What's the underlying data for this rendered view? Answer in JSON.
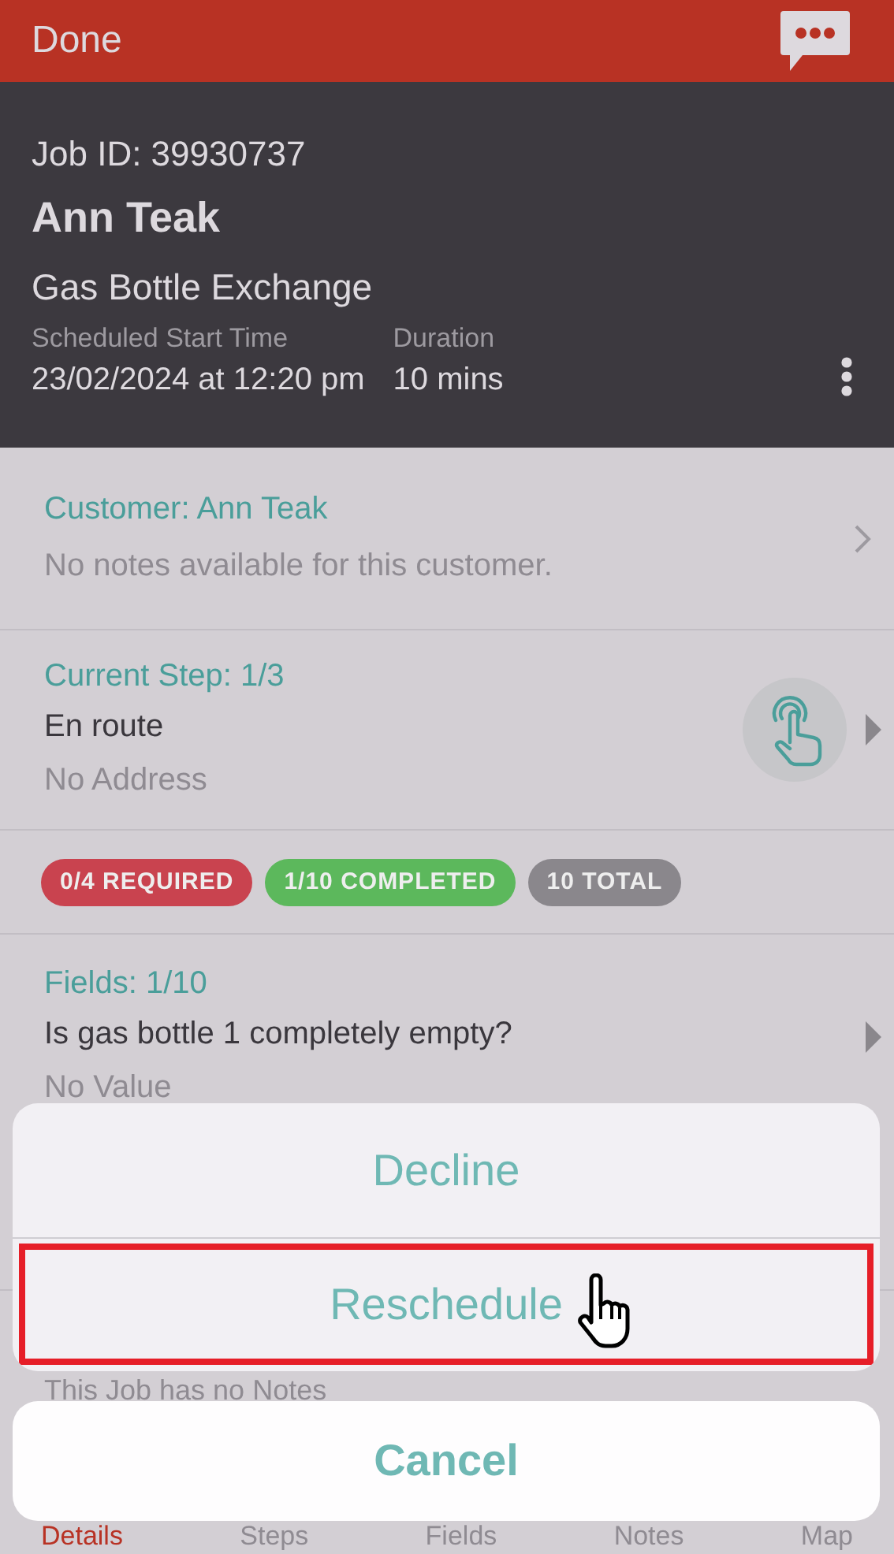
{
  "header": {
    "title": "Done"
  },
  "job": {
    "id_label": "Job ID: 39930737",
    "customer_name": "Ann Teak",
    "service": "Gas Bottle Exchange",
    "details": [
      {
        "label": "Scheduled Start Time",
        "value": "23/02/2024 at 12:20 pm"
      },
      {
        "label": "Duration",
        "value": "10 mins"
      }
    ]
  },
  "customer": {
    "title": "Customer: Ann Teak",
    "notes": "No notes available for this customer."
  },
  "current_step": {
    "title": "Current Step: 1/3",
    "name": "En route",
    "address": "No Address"
  },
  "badges": [
    {
      "label": "0/4 REQUIRED",
      "color": "#c9434f"
    },
    {
      "label": "1/10 COMPLETED",
      "color": "#5cb85c"
    },
    {
      "label": "10 TOTAL",
      "color": "#8a878c"
    }
  ],
  "fields": {
    "title": "Fields: 1/10",
    "question": "Is gas bottle 1 completely empty?",
    "value": "No Value"
  },
  "notes": {
    "text": "This Job has no Notes"
  },
  "tabs": [
    {
      "label": "Details",
      "selected": true
    },
    {
      "label": "Steps",
      "selected": false
    },
    {
      "label": "Fields",
      "selected": false
    },
    {
      "label": "Notes",
      "selected": false
    },
    {
      "label": "Map",
      "selected": false
    }
  ],
  "action_sheet": {
    "actions": [
      {
        "label": "Decline",
        "highlighted": false
      },
      {
        "label": "Reschedule",
        "highlighted": true
      }
    ],
    "cancel": "Cancel"
  }
}
